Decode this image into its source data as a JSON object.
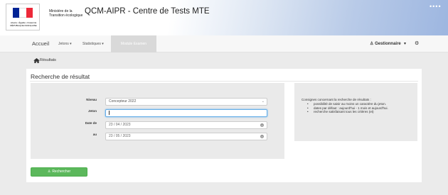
{
  "header": {
    "logo_text": "Liberté • Égalité • Fraternité RÉPUBLIQUE FRANÇAISE",
    "ministry": "Ministère de la Transition écologique",
    "title": "QCM-AIPR - Centre de Tests MTE",
    "flag_colors": [
      "#002395",
      "#ffffff",
      "#ed2939"
    ]
  },
  "nav": {
    "home": "Accueil",
    "jetons": "Jetons ▾",
    "stats": "Statistiques ▾",
    "active": "Module Examen",
    "user": "Gestionnaire",
    "user_caret": "▾"
  },
  "breadcrumb": {
    "label": "Résultats"
  },
  "card": {
    "title": "Recherche de résultat"
  },
  "form": {
    "niveau_label": "Niveau",
    "niveau_value": "Concepteur 2022",
    "jeton_label": "Jeton",
    "jeton_value": "",
    "date_label": "Date de",
    "date_value": "23 / 04 / 2023",
    "au_label": "au",
    "au_value": "23 / 05 / 2023"
  },
  "help": {
    "title": "Consignes concernant la recherche de résultats :",
    "items": [
      "possibilité de saisir au moins un caractère du jeton.",
      "dates par défaut : aujourd'hui - 1 mois et aujourd'hui.",
      "recherche satisfaisant tous les critères (et)"
    ]
  },
  "button": {
    "search_label": "Rechercher"
  },
  "colors": {
    "accent_green": "#5cb85c",
    "focus_blue": "#66afe9"
  }
}
